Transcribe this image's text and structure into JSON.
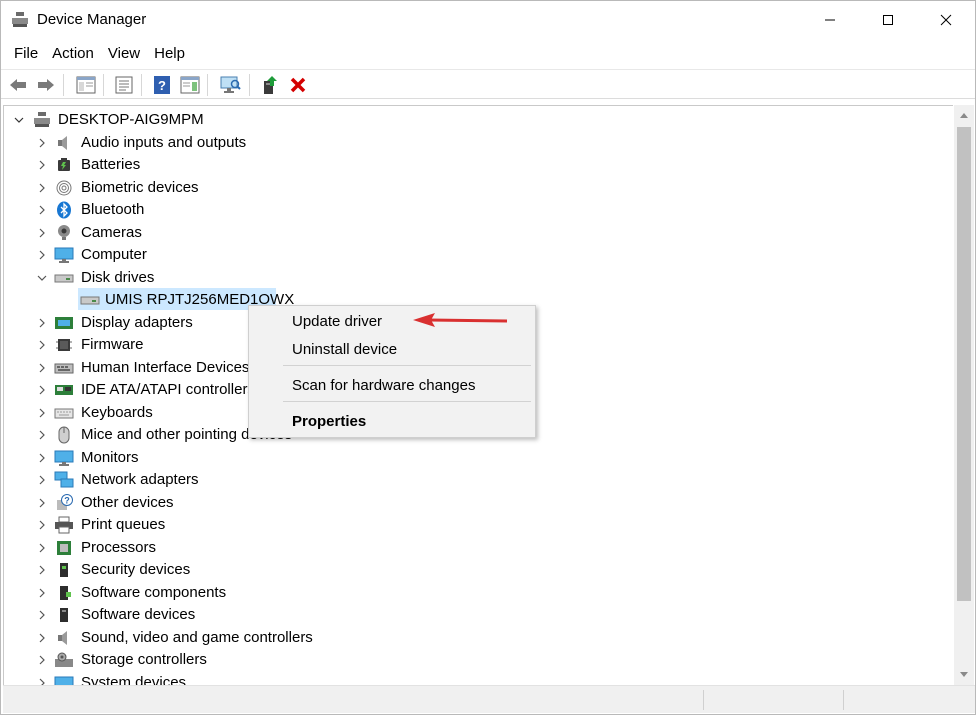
{
  "window": {
    "title": "Device Manager",
    "controls": {
      "minimize": "—",
      "maximize": "☐",
      "close": "✕"
    }
  },
  "menu": [
    "File",
    "Action",
    "View",
    "Help"
  ],
  "toolbar": {
    "buttons": [
      "back-icon",
      "forward-icon",
      "console-tree-icon",
      "properties-icon",
      "help-icon",
      "action-pane-icon",
      "scan-hardware-icon",
      "update-driver-icon",
      "uninstall-icon"
    ]
  },
  "tree": {
    "root": "DESKTOP-AIG9MPM",
    "categories": [
      {
        "label": "Audio inputs and outputs",
        "icon": "speaker-icon",
        "expanded": false
      },
      {
        "label": "Batteries",
        "icon": "battery-icon",
        "expanded": false
      },
      {
        "label": "Biometric devices",
        "icon": "fingerprint-icon",
        "expanded": false
      },
      {
        "label": "Bluetooth",
        "icon": "bluetooth-icon",
        "expanded": false
      },
      {
        "label": "Cameras",
        "icon": "camera-icon",
        "expanded": false
      },
      {
        "label": "Computer",
        "icon": "monitor-icon",
        "expanded": false
      },
      {
        "label": "Disk drives",
        "icon": "disk-drive-icon",
        "expanded": true,
        "children": [
          "UMIS RPJTJ256MED1OWX"
        ]
      },
      {
        "label": "Display adapters",
        "icon": "display-adapter-icon",
        "expanded": false
      },
      {
        "label": "Firmware",
        "icon": "firmware-icon",
        "expanded": false
      },
      {
        "label": "Human Interface Devices",
        "icon": "hid-icon",
        "expanded": false
      },
      {
        "label": "IDE ATA/ATAPI controllers",
        "icon": "ide-controller-icon",
        "expanded": false
      },
      {
        "label": "Keyboards",
        "icon": "keyboard-icon",
        "expanded": false
      },
      {
        "label": "Mice and other pointing devices",
        "icon": "mouse-icon",
        "expanded": false
      },
      {
        "label": "Monitors",
        "icon": "monitor-icon",
        "expanded": false
      },
      {
        "label": "Network adapters",
        "icon": "network-icon",
        "expanded": false
      },
      {
        "label": "Other devices",
        "icon": "unknown-device-icon",
        "expanded": false
      },
      {
        "label": "Print queues",
        "icon": "printer-icon",
        "expanded": false
      },
      {
        "label": "Processors",
        "icon": "processor-icon",
        "expanded": false
      },
      {
        "label": "Security devices",
        "icon": "security-device-icon",
        "expanded": false
      },
      {
        "label": "Software components",
        "icon": "software-component-icon",
        "expanded": false
      },
      {
        "label": "Software devices",
        "icon": "software-device-icon",
        "expanded": false
      },
      {
        "label": "Sound, video and game controllers",
        "icon": "speaker-icon",
        "expanded": false
      },
      {
        "label": "Storage controllers",
        "icon": "storage-controller-icon",
        "expanded": false
      },
      {
        "label": "System devices",
        "icon": "system-device-icon",
        "expanded": false
      }
    ]
  },
  "context_menu": {
    "items": [
      "Update driver",
      "Uninstall device",
      "Scan for hardware changes",
      "Properties"
    ]
  },
  "colors": {
    "selection": "#cce8ff",
    "annotation_arrow": "#d93030",
    "uninstall_red": "#d40000"
  }
}
